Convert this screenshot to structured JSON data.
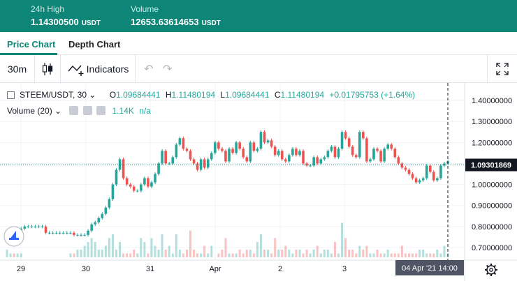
{
  "stats": [
    {
      "label": "24h High",
      "value": "1.14300500",
      "unit": "USDT"
    },
    {
      "label": "Volume",
      "value": "12653.63614653",
      "unit": "USDT"
    }
  ],
  "tabs": [
    {
      "label": "Price Chart",
      "active": true
    },
    {
      "label": "Depth Chart",
      "active": false
    }
  ],
  "toolbar": {
    "interval": "30m",
    "indicators_label": "Indicators",
    "undo_icon": "undo-icon",
    "redo_icon": "redo-icon",
    "fullscreen_icon": "fullscreen-icon"
  },
  "legend": {
    "symbol": "STEEM/USDT, 30",
    "open_key": "O",
    "open": "1.09684441",
    "high_key": "H",
    "high": "1.11480194",
    "low_key": "L",
    "low": "1.09684441",
    "close_key": "C",
    "close": "1.11480194",
    "change": "+0.01795753 (+1.64%)",
    "volume_label": "Volume (20)",
    "volume_value": "1.14K",
    "volume_na": "n/a"
  },
  "price_axis": {
    "ticks": [
      "1.40000000",
      "1.30000000",
      "1.20000000",
      "1.10000000",
      "1.00000000",
      "0.90000000",
      "0.80000000",
      "0.70000000"
    ],
    "current_price": "1.09301869"
  },
  "time_axis": {
    "ticks": [
      "29",
      "30",
      "31",
      "Apr",
      "2",
      "3"
    ],
    "crosshair_label": "04 Apr '21   14:00"
  },
  "colors": {
    "brand": "#0d8577",
    "up": "#26a69a",
    "down": "#ef5350"
  },
  "chart_data": {
    "type": "candlestick",
    "symbol": "STEEM/USDT",
    "interval": "30m",
    "ylim": [
      0.66,
      1.45
    ],
    "xlabel": "",
    "ylabel": "",
    "x_ticks": [
      "29",
      "30",
      "31",
      "Apr",
      "2",
      "3"
    ],
    "close_prices": [
      0.74,
      0.75,
      0.74,
      0.78,
      0.79,
      0.8,
      0.8,
      0.8,
      0.8,
      0.8,
      0.8,
      0.77,
      0.77,
      0.77,
      0.77,
      0.77,
      0.77,
      0.77,
      0.77,
      0.76,
      0.76,
      0.76,
      0.76,
      0.78,
      0.81,
      0.82,
      0.84,
      0.86,
      0.89,
      0.93,
      1.0,
      1.07,
      1.12,
      1.03,
      1.0,
      0.99,
      0.97,
      0.97,
      1.0,
      1.03,
      0.99,
      1.01,
      1.05,
      1.1,
      1.16,
      1.1,
      1.1,
      1.13,
      1.19,
      1.22,
      1.17,
      1.16,
      1.12,
      1.1,
      1.07,
      1.12,
      1.08,
      1.12,
      1.15,
      1.2,
      1.17,
      1.16,
      1.11,
      1.17,
      1.15,
      1.2,
      1.17,
      1.13,
      1.11,
      1.2,
      1.16,
      1.17,
      1.25,
      1.2,
      1.21,
      1.18,
      1.14,
      1.16,
      1.12,
      1.11,
      1.14,
      1.17,
      1.14,
      1.16,
      1.1,
      1.09,
      1.09,
      1.13,
      1.1,
      1.12,
      1.13,
      1.16,
      1.18,
      1.13,
      1.17,
      1.25,
      1.22,
      1.18,
      1.14,
      1.13,
      1.25,
      1.22,
      1.11,
      1.12,
      1.17,
      1.16,
      1.11,
      1.17,
      1.19,
      1.17,
      1.13,
      1.1,
      1.08,
      1.07,
      1.05,
      1.03,
      1.01,
      1.02,
      1.03,
      1.09,
      1.06,
      1.02,
      1.03,
      1.09,
      1.1,
      1.11
    ],
    "volume_relative": [
      0.2,
      0.1,
      0.1,
      0.1,
      0.1,
      0.0,
      0.0,
      0.0,
      0.0,
      0.0,
      0.0,
      0.0,
      0.0,
      0.0,
      0.0,
      0.0,
      0.0,
      0.0,
      0.1,
      0.1,
      0.2,
      0.2,
      0.3,
      0.4,
      0.5,
      0.4,
      0.2,
      0.2,
      0.3,
      0.5,
      0.6,
      0.2,
      0.4,
      0.1,
      0.1,
      0.1,
      0.2,
      0.1,
      0.5,
      0.4,
      0.1,
      0.5,
      0.3,
      0.2,
      0.6,
      0.2,
      0.3,
      0.1,
      0.6,
      0.2,
      0.1,
      0.2,
      0.7,
      0.2,
      0.1,
      0.1,
      0.3,
      0.1,
      0.3,
      0.0,
      0.1,
      0.2,
      0.5,
      0.1,
      0.1,
      0.1,
      0.2,
      0.1,
      0.2,
      0.2,
      0.1,
      0.4,
      0.6,
      0.2,
      0.2,
      0.1,
      0.5,
      0.2,
      0.2,
      0.3,
      0.2,
      0.1,
      0.2,
      0.2,
      0.1,
      0.2,
      0.1,
      0.2,
      0.3,
      0.1,
      0.2,
      0.2,
      0.1,
      0.4,
      0.1,
      0.9,
      0.5,
      0.2,
      0.2,
      0.1,
      0.3,
      0.2,
      0.3,
      0.1,
      0.1,
      0.2,
      0.1,
      0.1,
      0.2,
      0.1,
      0.1,
      0.1,
      0.3,
      0.1,
      0.1,
      0.1,
      0.1,
      0.2,
      0.2,
      0.1,
      0.1,
      0.1,
      0.2,
      0.1,
      0.3,
      0.1
    ]
  }
}
